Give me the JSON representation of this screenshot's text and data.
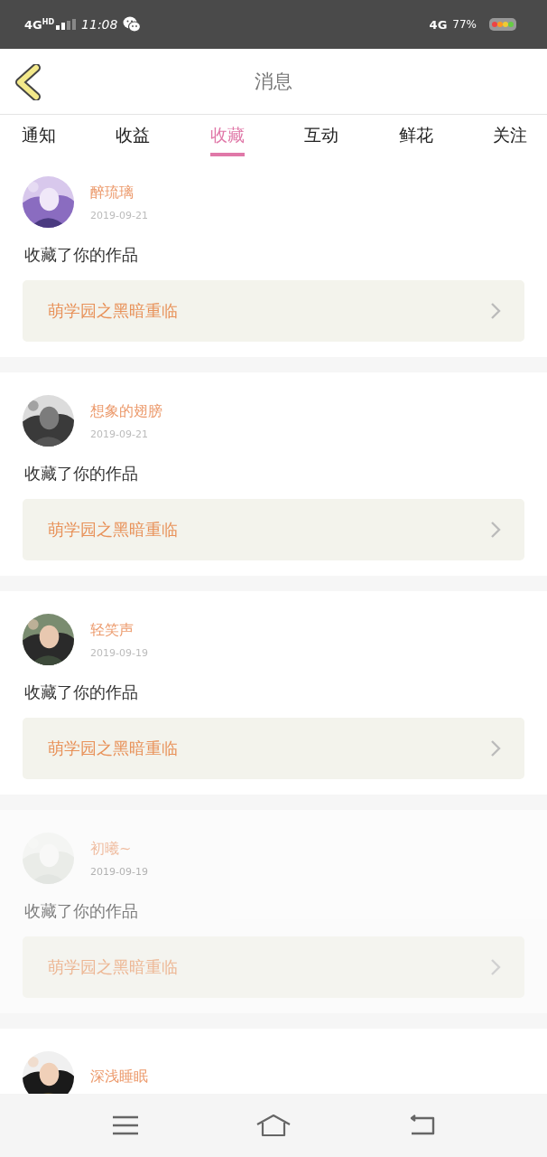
{
  "status_bar": {
    "network_left": "4G",
    "network_left_sup": "HD",
    "time": "11:08",
    "network_right": "4G",
    "battery": "77%"
  },
  "header": {
    "title": "消息"
  },
  "tabs": [
    {
      "label": "通知",
      "selected": false
    },
    {
      "label": "收益",
      "selected": false
    },
    {
      "label": "收藏",
      "selected": true
    },
    {
      "label": "互动",
      "selected": false
    },
    {
      "label": "鲜花",
      "selected": false
    },
    {
      "label": "关注",
      "selected": false
    }
  ],
  "messages": [
    {
      "user": "醉琉璃",
      "date": "2019-09-21",
      "text": "收藏了你的作品",
      "work": "萌学园之黑暗重临",
      "faded": false
    },
    {
      "user": "想象的翅膀",
      "date": "2019-09-21",
      "text": "收藏了你的作品",
      "work": "萌学园之黑暗重临",
      "faded": false
    },
    {
      "user": "轻笑声",
      "date": "2019-09-19",
      "text": "收藏了你的作品",
      "work": "萌学园之黑暗重临",
      "faded": false
    },
    {
      "user": "初曦~",
      "date": "2019-09-19",
      "text": "收藏了你的作品",
      "work": "萌学园之黑暗重临",
      "faded": true
    },
    {
      "user": "深浅睡眠",
      "faded": false
    }
  ]
}
